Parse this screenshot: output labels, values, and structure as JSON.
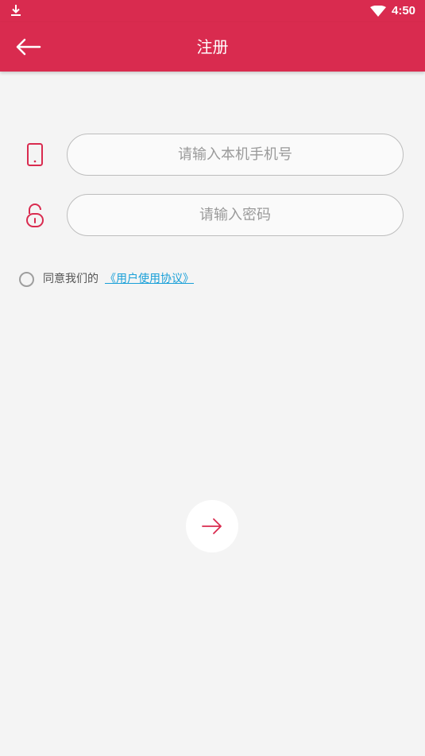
{
  "status_bar": {
    "time": "4:50",
    "icons": [
      "download-icon",
      "wifi-icon"
    ]
  },
  "header": {
    "title": "注册",
    "back_icon": "arrow-left-icon",
    "color": "#d92b4f"
  },
  "form": {
    "phone": {
      "placeholder": "请输入本机手机号",
      "value": "",
      "icon": "phone-icon"
    },
    "password": {
      "placeholder": "请输入密码",
      "value": "",
      "icon": "unlock-icon"
    },
    "agreement": {
      "prefix": "同意我们的",
      "link": "《用户使用协议》",
      "checked": false,
      "link_color": "#1aa0d8"
    }
  },
  "next_button": {
    "icon": "arrow-right-icon",
    "color": "#d92b4f"
  }
}
